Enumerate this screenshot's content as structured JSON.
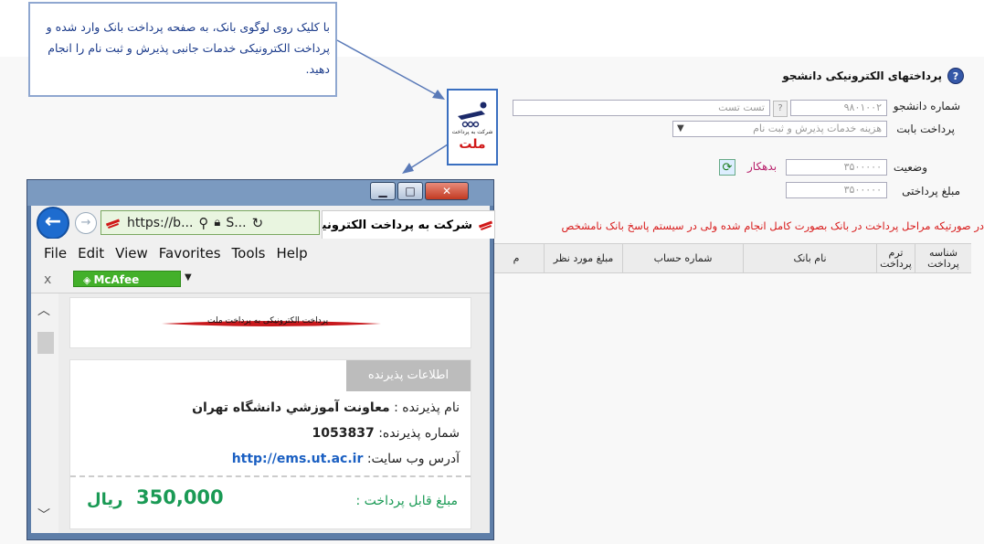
{
  "callout": {
    "lines": [
      "با کلیک روی لوگوی بانک، به صفحه پرداخت بانک وارد شده و",
      "پرداخت الکترونیکی خدمات جانبی پذیرش و ثبت نام  را انجام",
      "دهید."
    ]
  },
  "page": {
    "title": "پرداختهای الکترونیکی دانشجو",
    "student_no_label": "شماره دانشجو",
    "student_no_value": "۹۸۰۱۰۰۲",
    "student_name_value": "تست تست",
    "payment_for_label": "پرداخت بابت",
    "payment_for_value": "هزینه خدمات پذیرش و ثبت نام",
    "status_label": "وضعیت",
    "status_value": "۳۵۰۰۰۰۰",
    "status_text": "بدهکار",
    "amount_label": "مبلغ پرداختی",
    "amount_value": "۳۵۰۰۰۰۰",
    "warning": "در صورتیکه مراحل پرداخت در بانک بصورت کامل انجام شده ولی در سیستم پاسخ بانک نامشخص",
    "table_headers": [
      "شناسه پرداخت",
      "ترم پرداخت",
      "نام بانک",
      "شماره حساب",
      "مبلغ مورد نظر",
      "م"
    ]
  },
  "bank_logo": {
    "sub": "شرکت به پرداخت",
    "name": "ملت"
  },
  "browser": {
    "address": "https://b...",
    "address_tail": "S...",
    "tab_title": "شرکت به پرداخت الکترونیکی",
    "menu": [
      "File",
      "Edit",
      "View",
      "Favorites",
      "Tools",
      "Help"
    ],
    "close_x": "x",
    "mcafee": "McAfee",
    "banner_text": "پرداخت الکترونیکی به پرداخت ملت",
    "merchant_badge": "اطلاعات پذیرنده",
    "merchant_name_label": "نام پذیرنده : ",
    "merchant_name": "معاونت آموزشي دانشگاه تهران",
    "merchant_no_label": "شماره پذیرنده: ",
    "merchant_no": "1053837",
    "site_label": "آدرس وب سایت: ",
    "site_url": "http://ems.ut.ac.ir",
    "payable_label": "مبلغ قابل پرداخت :",
    "payable_amount": "350,000",
    "currency": "ریال"
  }
}
